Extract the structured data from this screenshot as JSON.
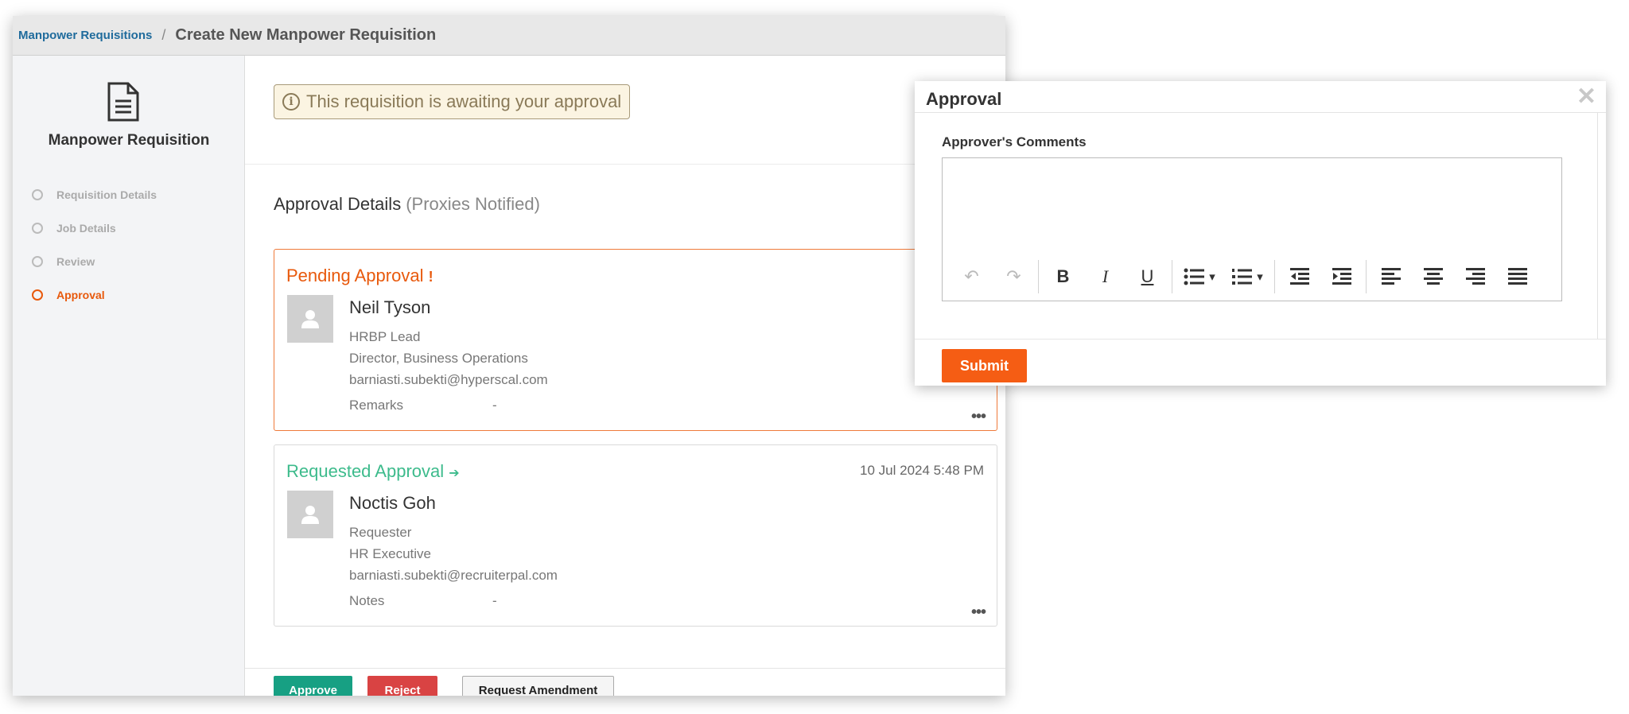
{
  "breadcrumb": {
    "parent": "Manpower Requisitions",
    "separator": "/",
    "current": "Create New Manpower Requisition"
  },
  "sidebar": {
    "title": "Manpower Requisition",
    "icon": "document-icon",
    "steps": [
      {
        "label": "Requisition Details",
        "state": "pending"
      },
      {
        "label": "Job Details",
        "state": "pending"
      },
      {
        "label": "Review",
        "state": "pending"
      },
      {
        "label": "Approval",
        "state": "active"
      }
    ]
  },
  "alert": {
    "icon": "info-icon",
    "symbol": "i",
    "text": "This requisition is awaiting your approval"
  },
  "approval": {
    "title": "Approval Details",
    "subtitle": "(Proxies Notified)",
    "cards": [
      {
        "status": "Pending Approval",
        "status_mark": "!",
        "date": "",
        "name": "Neil Tyson",
        "role": "HRBP Lead",
        "position": "Director, Business Operations",
        "email": "barniasti.subekti@hyperscal.com",
        "field_label": "Remarks",
        "field_value": "-",
        "more": "•••"
      },
      {
        "status": "Requested Approval",
        "status_mark": "➔",
        "date": "10 Jul 2024 5:48 PM",
        "name": "Noctis Goh",
        "role": "Requester",
        "position": "HR Executive",
        "email": "barniasti.subekti@recruiterpal.com",
        "field_label": "Notes",
        "field_value": "-",
        "more": "•••"
      }
    ]
  },
  "actions": {
    "approve": "Approve",
    "reject": "Reject",
    "amend": "Request Amendment"
  },
  "modal": {
    "title": "Approval",
    "close": "✕",
    "comments_label": "Approver's Comments",
    "submit": "Submit",
    "toolbar": {
      "undo": "↶",
      "redo": "↷",
      "bold": "B",
      "italic": "I",
      "underline": "U",
      "caret": "▾"
    }
  },
  "colors": {
    "accent": "#e8590c",
    "approve": "#17a083",
    "reject": "#d94343",
    "requested": "#3dbb8c"
  }
}
